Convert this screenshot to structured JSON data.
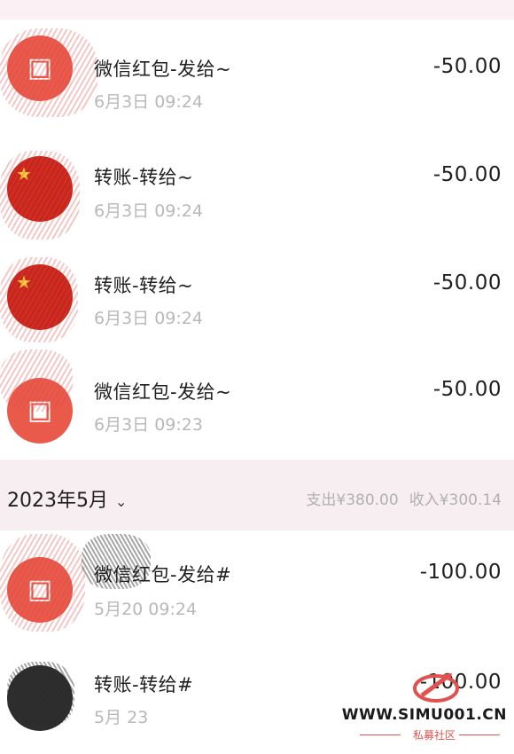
{
  "transactions_top": [
    {
      "title": "微信红包-发给~",
      "time": "6月3日 09:24",
      "amount": "-50.00",
      "avatar": "red-packet-icon"
    },
    {
      "title": "转账-转给~",
      "time": "6月3日 09:24",
      "amount": "-50.00",
      "avatar": "flag-avatar"
    },
    {
      "title": "转账-转给~",
      "time": "6月3日 09:24",
      "amount": "-50.00",
      "avatar": "flag-avatar"
    },
    {
      "title": "微信红包-发给~",
      "time": "6月3日 09:23",
      "amount": "-50.00",
      "avatar": "red-packet-icon"
    }
  ],
  "month_header": {
    "label": "2023年5月",
    "expense": "支出¥380.00",
    "income": "收入¥300.14"
  },
  "transactions_may": [
    {
      "title": "微信红包-发给#",
      "time": "5月20 09:24",
      "amount": "-100.00",
      "avatar": "red-packet-icon"
    },
    {
      "title": "转账-转给#",
      "time": "5月 23",
      "amount": "-100.00",
      "avatar": "dark-avatar"
    }
  ],
  "watermark": {
    "site": "WWW.SIMU001.CN",
    "sub": "私募社区"
  },
  "colors": {
    "redpacket": "#e95a4b",
    "flag": "#c8261b",
    "muted": "#b8b8b8",
    "month_bar": "#f7eef1"
  }
}
